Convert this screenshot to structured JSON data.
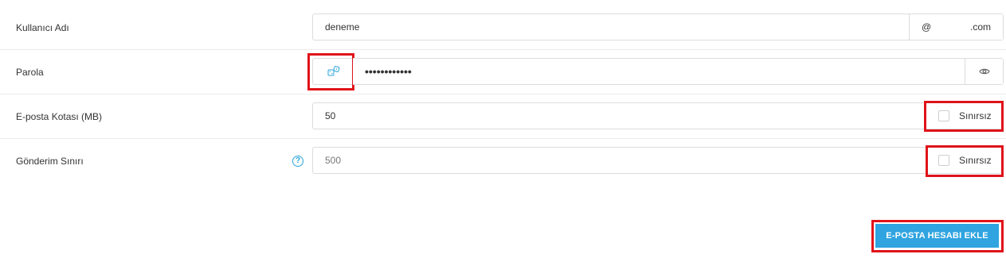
{
  "form": {
    "username": {
      "label": "Kullanıcı Adı",
      "value": "deneme",
      "domain_prefix": "@",
      "domain_suffix": ".com"
    },
    "password": {
      "label": "Parola",
      "value": "••••••••••••",
      "generate_icon": "dice-icon",
      "toggle_icon": "eye-icon"
    },
    "quota": {
      "label": "E-posta Kotası (MB)",
      "value": "50",
      "unlimited_label": "Sınırsız",
      "unlimited_checked": false
    },
    "send_limit": {
      "label": "Gönderim Sınırı",
      "help_glyph": "?",
      "value": "500",
      "unlimited_label": "Sınırsız",
      "unlimited_checked": false
    },
    "submit_label": "E-POSTA HESABI EKLE"
  },
  "colors": {
    "accent": "#2fa4e0",
    "highlight": "#e0131a",
    "help": "#2aa5db"
  }
}
